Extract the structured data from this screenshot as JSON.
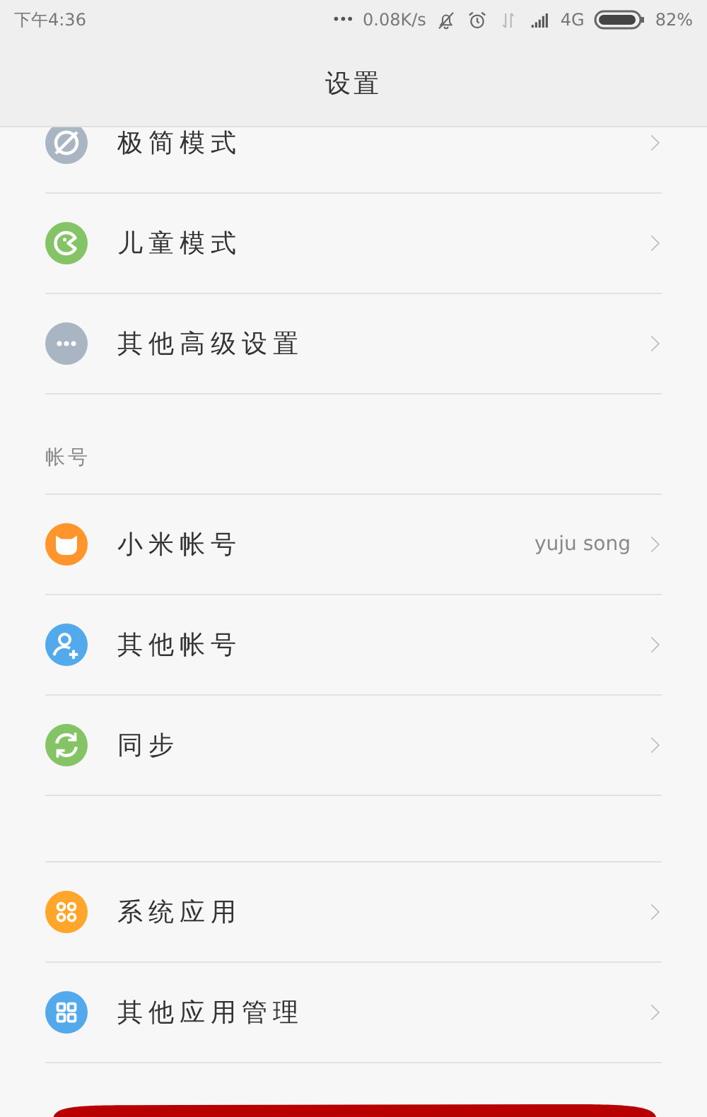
{
  "status_bar": {
    "time": "下午4:36",
    "more": "•••",
    "speed": "0.08K/s",
    "network": "4G",
    "battery": "82%"
  },
  "title": "设置",
  "sections": [
    {
      "items": [
        {
          "label": "极简模式",
          "color": "#a9b5c3"
        },
        {
          "label": "儿童模式",
          "color": "#85c466"
        },
        {
          "label": "其他高级设置",
          "color": "#a9b5c3"
        }
      ]
    },
    {
      "header": "帐号",
      "items": [
        {
          "label": "小米帐号",
          "value": "yuju song",
          "color": "#ff952b"
        },
        {
          "label": "其他帐号",
          "color": "#52a9ec"
        },
        {
          "label": "同步",
          "color": "#85c466"
        }
      ]
    },
    {
      "items": [
        {
          "label": "系统应用",
          "color": "#ffa62b"
        },
        {
          "label": "其他应用管理",
          "color": "#52a9ec"
        }
      ]
    }
  ]
}
